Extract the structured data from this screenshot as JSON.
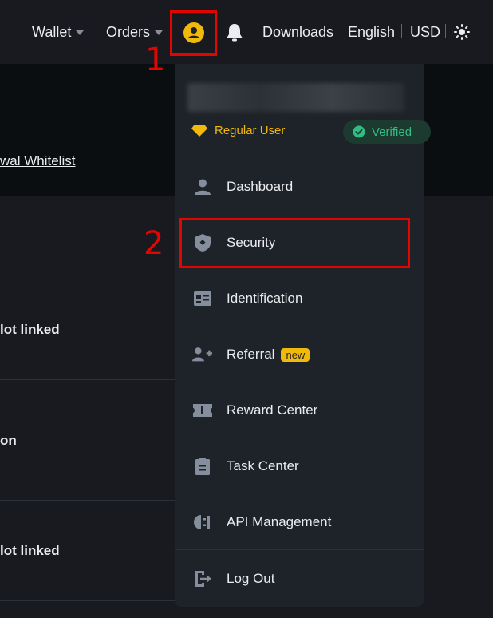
{
  "topbar": {
    "wallet": "Wallet",
    "orders": "Orders",
    "downloads": "Downloads",
    "language": "English",
    "currency": "USD"
  },
  "page": {
    "whitelist_link": "wal Whitelist",
    "rows": [
      "lot linked",
      "on",
      "lot linked"
    ]
  },
  "dropdown": {
    "user_level": "Regular User",
    "verified": "Verified",
    "items": [
      {
        "label": "Dashboard",
        "icon": "user-icon"
      },
      {
        "label": "Security",
        "icon": "shield-icon"
      },
      {
        "label": "Identification",
        "icon": "id-card-icon"
      },
      {
        "label": "Referral",
        "icon": "add-user-icon",
        "badge": "new"
      },
      {
        "label": "Reward Center",
        "icon": "ticket-icon"
      },
      {
        "label": "Task Center",
        "icon": "clipboard-icon"
      },
      {
        "label": "API Management",
        "icon": "api-icon"
      },
      {
        "label": "Log Out",
        "icon": "logout-icon"
      }
    ]
  },
  "annotations": {
    "step1": "1",
    "step2": "2"
  },
  "colors": {
    "accent": "#F0B90B",
    "verified_green": "#2EBD85",
    "annotation_red": "#E10600"
  }
}
